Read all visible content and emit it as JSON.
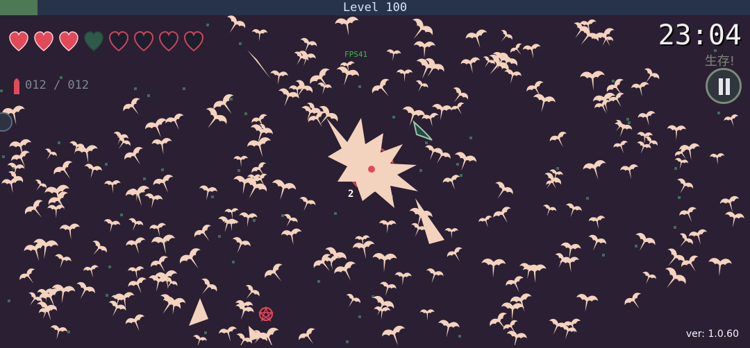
{
  "hud": {
    "level_text": "Level 100",
    "xp_progress": 0.05,
    "health": {
      "total": 8,
      "filled": 3,
      "empty_special": 1,
      "empty": 4
    },
    "ammo": {
      "text": "012 / 012"
    },
    "timer": "23:04",
    "status_text": "生存!",
    "fps_text": "FPS41",
    "combo_text": "2",
    "version_text": "ver: 1.0.60"
  },
  "colors": {
    "background": "#2b1f33",
    "enemy": "#f3d3bd",
    "heart_filled": "#e24a5a",
    "heart_empty": "#d14458",
    "heart_special": "#2e5a4a",
    "xp_fill": "#4d7a55",
    "xp_bar": "#26334a",
    "fps_green": "#3bbd44"
  },
  "icons": {
    "heart": "heart-icon",
    "ammo": "bullet-icon",
    "pause": "pause-icon"
  }
}
